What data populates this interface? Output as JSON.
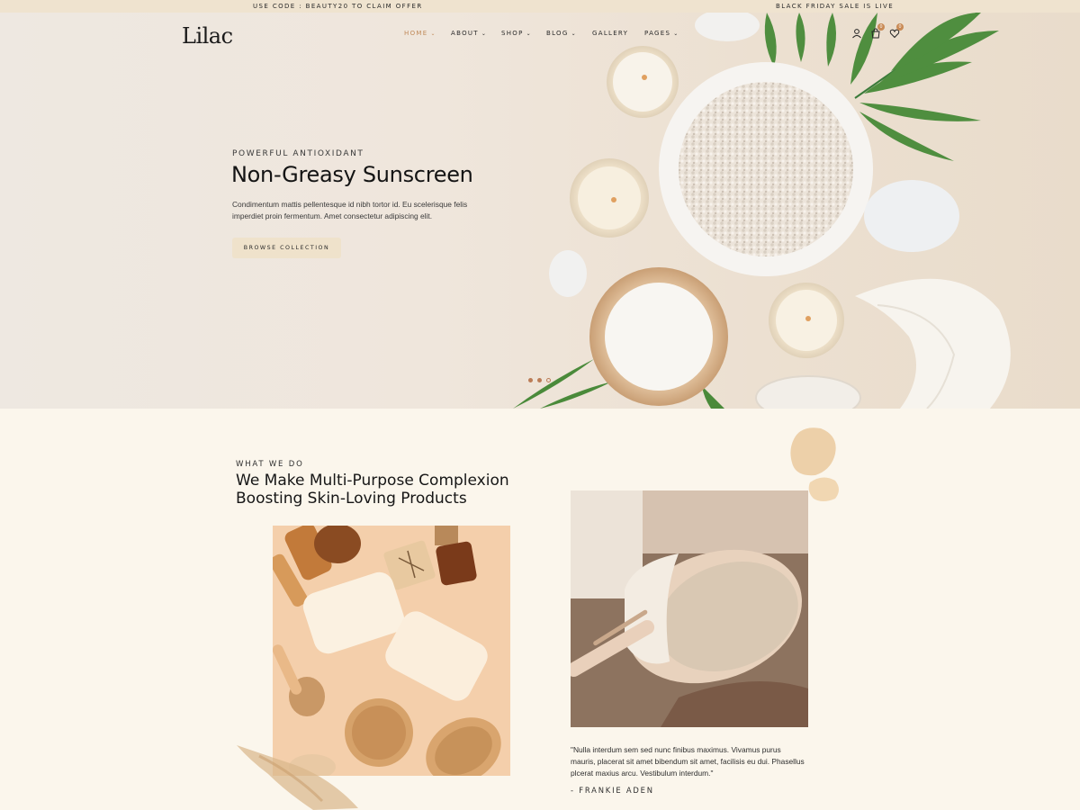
{
  "topbar": {
    "promo_left": "USE CODE : BEAUTY20 TO CLAIM OFFER",
    "promo_right": "BLACK FRIDAY SALE IS LIVE"
  },
  "header": {
    "logo": "Lilac",
    "nav": [
      {
        "label": "HOME",
        "has_caret": true,
        "active": true
      },
      {
        "label": "ABOUT",
        "has_caret": true,
        "active": false
      },
      {
        "label": "SHOP",
        "has_caret": true,
        "active": false
      },
      {
        "label": "BLOG",
        "has_caret": true,
        "active": false
      },
      {
        "label": "GALLERY",
        "has_caret": false,
        "active": false
      },
      {
        "label": "PAGES",
        "has_caret": true,
        "active": false
      }
    ],
    "caret": "⌄",
    "icons": [
      {
        "name": "user-icon",
        "badge": ""
      },
      {
        "name": "cart-icon",
        "badge": "0"
      },
      {
        "name": "wishlist-icon",
        "badge": "0"
      }
    ],
    "accent_color": "#c08a5a"
  },
  "hero": {
    "eyebrow": "POWERFUL ANTIOXIDANT",
    "title": "Non-Greasy Sunscreen",
    "description": "Condimentum mattis pellentesque id nibh tortor id. Eu scelerisque felis imperdiet proin fermentum. Amet consectetur adipiscing elit.",
    "button": "BROWSE COLLECTION",
    "slides": 3,
    "active_slide": 1
  },
  "about": {
    "eyebrow": "WHAT WE DO",
    "title": "We Make Multi-Purpose Complexion Boosting Skin-Loving Products",
    "quote": "\"Nulla interdum sem sed nunc finibus maximus. Vivamus purus mauris, placerat sit amet bibendum sit amet, facilisis eu dui. Phasellus plcerat maxius arcu. Vestibulum interdum.\"",
    "author": "- FRANKIE ADEN"
  },
  "colors": {
    "topbar": "#efe3cf",
    "page_bg": "#fbf6ec",
    "button_bg": "#efe2cb",
    "badge": "#c98a55"
  }
}
